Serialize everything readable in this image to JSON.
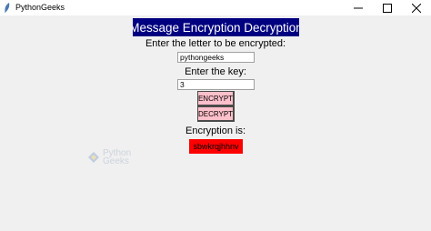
{
  "window": {
    "title": "PythonGeeks",
    "controls": {
      "minimize_icon": "minimize-icon",
      "maximize_icon": "maximize-icon",
      "close_icon": "close-icon"
    }
  },
  "main": {
    "heading": "Message Encryption Decryption",
    "text_label": "Enter the letter to be encrypted:",
    "text_value": "pythongeeks",
    "key_label": "Enter the key:",
    "key_value": "3",
    "encrypt_label": "ENCRYPT",
    "decrypt_label": "DECRYPT",
    "result_label": "Encryption is:",
    "result_value": "sbwkrqjhhnv"
  },
  "watermark": {
    "line1": "Python",
    "line2": "Geeks"
  },
  "colors": {
    "heading_bg": "#000080",
    "button_bg": "#ffc0cb",
    "result_bg": "#ff0000",
    "window_bg": "#f0f0f0"
  }
}
